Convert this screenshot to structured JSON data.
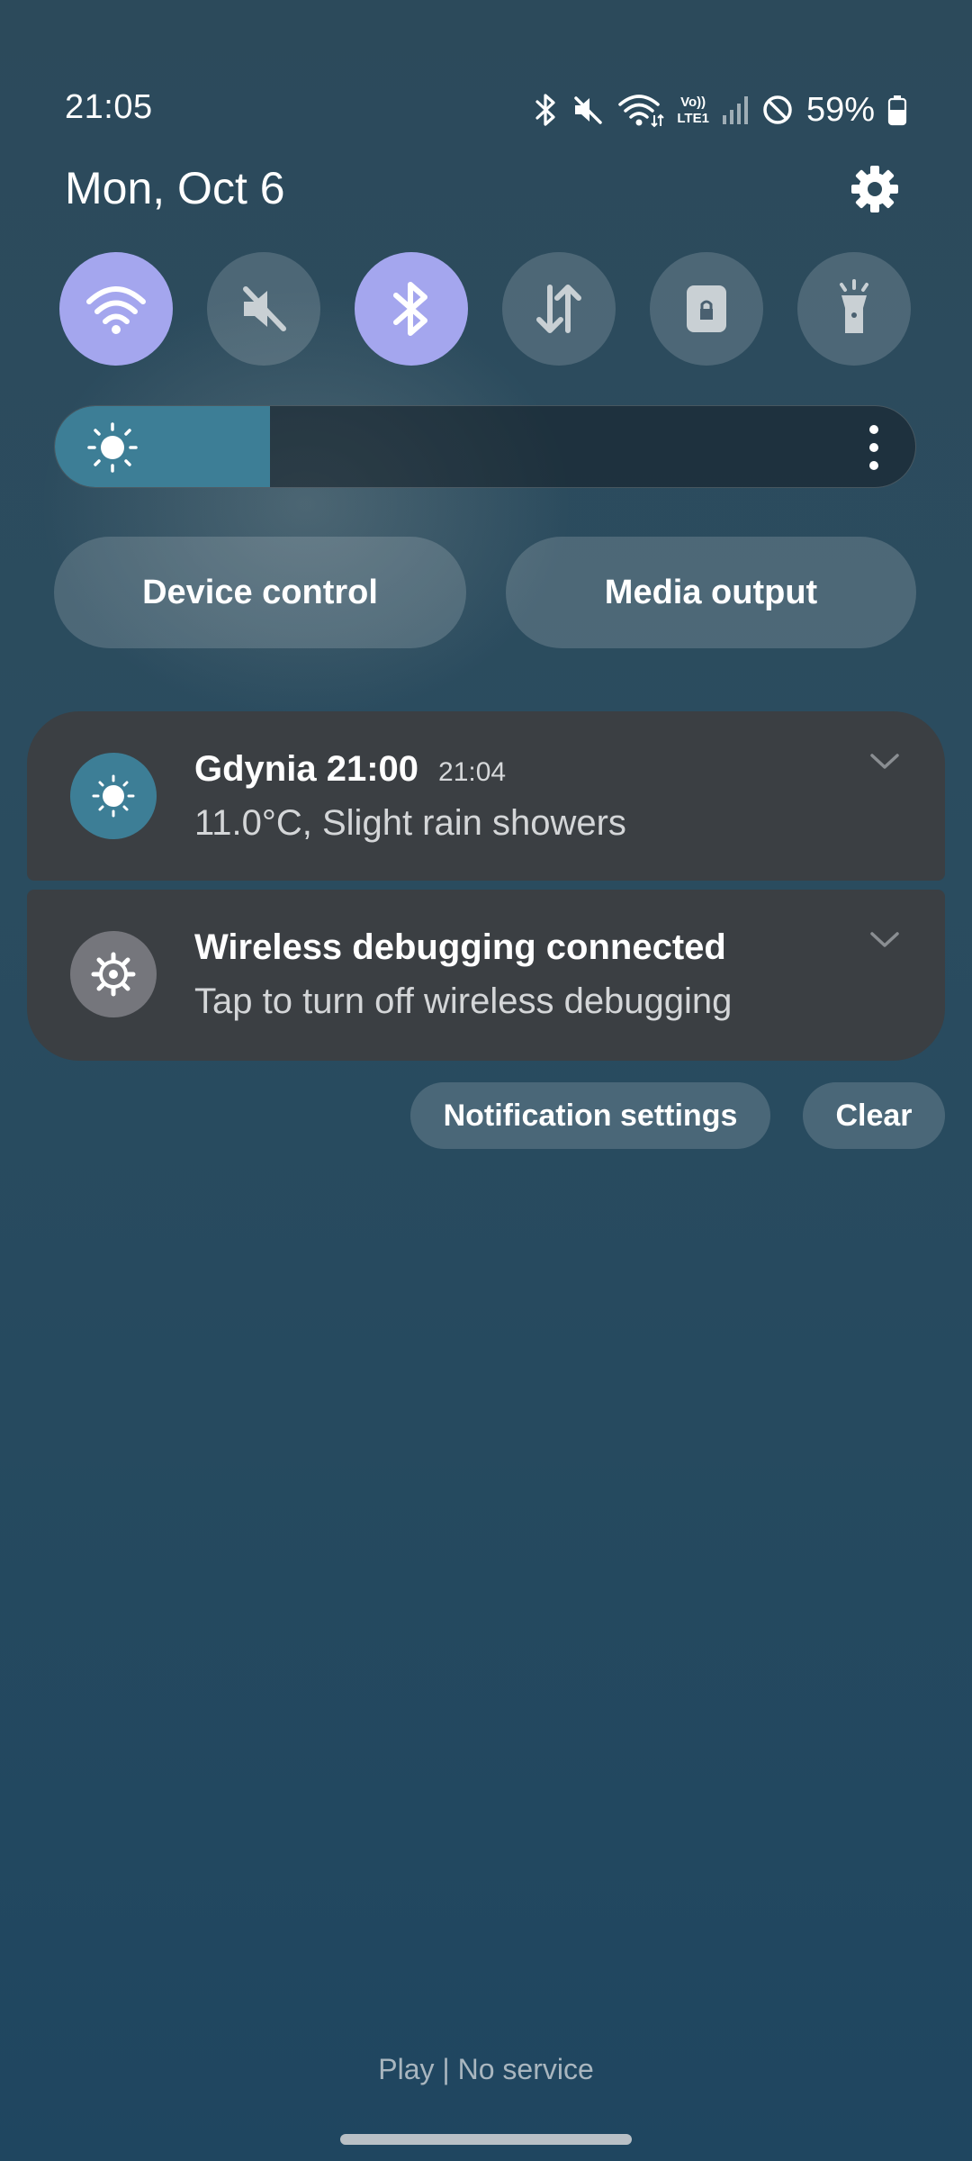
{
  "status_bar": {
    "time": "21:05",
    "network_label_top": "Vo))",
    "network_label_bottom": "LTE1",
    "battery": "59%"
  },
  "header": {
    "date": "Mon, Oct 6"
  },
  "quick_tiles": [
    {
      "name": "wifi",
      "active": true
    },
    {
      "name": "sound-mute",
      "active": false
    },
    {
      "name": "bluetooth",
      "active": true
    },
    {
      "name": "mobile-data",
      "active": false
    },
    {
      "name": "screen-lock",
      "active": false
    },
    {
      "name": "flashlight",
      "active": false
    }
  ],
  "brightness": {
    "level_percent": 25
  },
  "buttons": {
    "device_control": "Device control",
    "media_output": "Media output"
  },
  "notifications": [
    {
      "title": "Gdynia 21:00",
      "time": "21:04",
      "body": "11.0°C, Slight rain showers",
      "icon": "sun-icon"
    },
    {
      "title": "Wireless debugging connected",
      "time": "",
      "body": "Tap to turn off wireless debugging",
      "icon": "settings-gear-icon"
    }
  ],
  "actions": {
    "notification_settings": "Notification settings",
    "clear": "Clear"
  },
  "footer": {
    "carrier": "Play | No service"
  },
  "colors": {
    "tile_active": "#a4a6ee",
    "brightness_fill": "#3d7e96",
    "notification_bg": "#3b3f43"
  }
}
